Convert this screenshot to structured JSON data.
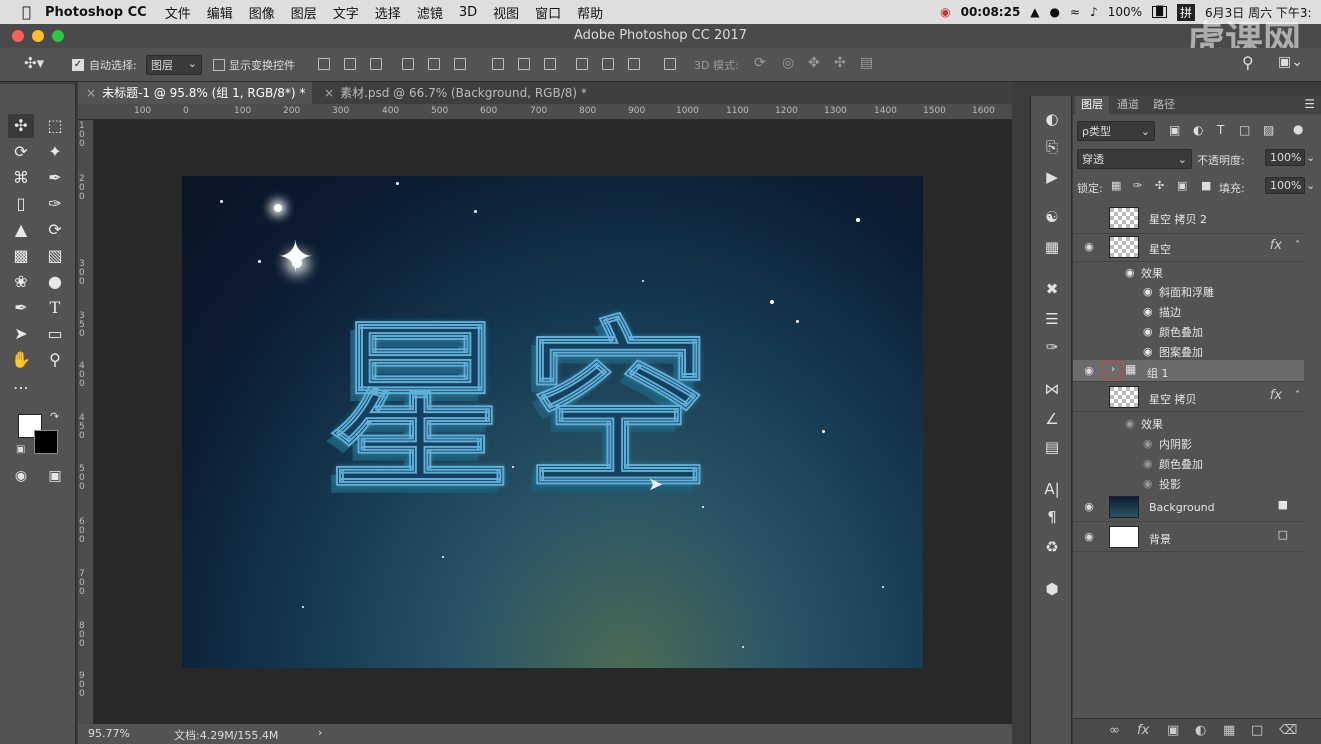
{
  "menubar": {
    "app_name": "Photoshop CC",
    "items": [
      "文件",
      "编辑",
      "图像",
      "图层",
      "文字",
      "选择",
      "滤镜",
      "3D",
      "视图",
      "窗口",
      "帮助"
    ],
    "timer": "00:08:25",
    "battery": "100%",
    "datetime": "6月3日 周六 下午3:"
  },
  "window": {
    "title": "Adobe Photoshop CC 2017",
    "watermark": "虎课网"
  },
  "options_bar": {
    "auto_select_label": "自动选择:",
    "auto_select_value": "图层",
    "show_transform_label": "显示变换控件",
    "mode_3d_label": "3D 模式:"
  },
  "tabs": [
    {
      "label": "未标题-1 @ 95.8% (组 1, RGB/8*) *",
      "active": true
    },
    {
      "label": "素材.psd @ 66.7% (Background, RGB/8) *",
      "active": false
    }
  ],
  "ruler": {
    "h": [
      "100",
      "0",
      "100",
      "200",
      "300",
      "400",
      "500",
      "600",
      "700",
      "800",
      "900",
      "1000",
      "1100",
      "1200",
      "1300",
      "1400",
      "1500",
      "1600"
    ],
    "v": [
      "1",
      "0",
      "0",
      "1",
      "5",
      "0",
      "2",
      "0",
      "0",
      "2",
      "5",
      "0",
      "3",
      "0",
      "0",
      "3",
      "5",
      "0",
      "4",
      "0",
      "0",
      "4",
      "5",
      "0",
      "5",
      "0",
      "0",
      "5",
      "5",
      "0",
      "6",
      "0",
      "0",
      "6",
      "5",
      "0",
      "7",
      "0",
      "0",
      "7",
      "5",
      "0",
      "8",
      "0",
      "0",
      "8",
      "5",
      "0",
      "9",
      "0",
      "0",
      "9",
      "5",
      "0",
      "1",
      "0",
      "0",
      "0"
    ]
  },
  "artwork": {
    "text": "星空",
    "colors": {
      "face": "#1a4a6a",
      "edge": "#5fb0d8",
      "side": "#1d5c75"
    }
  },
  "status": {
    "zoom": "95.77%",
    "doc": "文档:4.29M/155.4M"
  },
  "layers_panel": {
    "tabs": [
      "图层",
      "通道",
      "路径"
    ],
    "filter_label": "ρ类型",
    "blend_mode": "穿透",
    "opacity_label": "不透明度:",
    "opacity_value": "100%",
    "lock_label": "锁定:",
    "fill_label": "填充:",
    "fill_value": "100%",
    "layers": [
      {
        "name": "星空 拷贝 2",
        "visible": false,
        "fx": false
      },
      {
        "name": "星空",
        "visible": true,
        "fx": true,
        "effects_label": "效果",
        "effects": [
          "斜面和浮雕",
          "描边",
          "颜色叠加",
          "图案叠加"
        ]
      },
      {
        "name": "组 1",
        "visible": true,
        "group": true
      },
      {
        "name": "星空 拷贝",
        "visible": false,
        "fx": true,
        "effects_label": "效果",
        "effects": [
          "内阴影",
          "颜色叠加",
          "投影"
        ]
      },
      {
        "name": "Background",
        "visible": true,
        "locked": true
      },
      {
        "name": "背景",
        "visible": true,
        "locked": true
      }
    ],
    "fx_symbol": "fx"
  },
  "icons": [
    "apple-icon",
    "move-tool-icon",
    "marquee-icon",
    "lasso-icon",
    "magic-wand-icon",
    "crop-icon",
    "eyedropper-icon",
    "healing-icon",
    "brush-icon",
    "stamp-icon",
    "history-brush-icon",
    "eraser-icon",
    "gradient-icon",
    "blur-icon",
    "dodge-icon",
    "pen-icon",
    "type-icon",
    "path-select-icon",
    "rectangle-icon",
    "hand-icon",
    "zoom-icon",
    "eye-icon",
    "lock-icon",
    "folder-icon",
    "trash-icon"
  ]
}
